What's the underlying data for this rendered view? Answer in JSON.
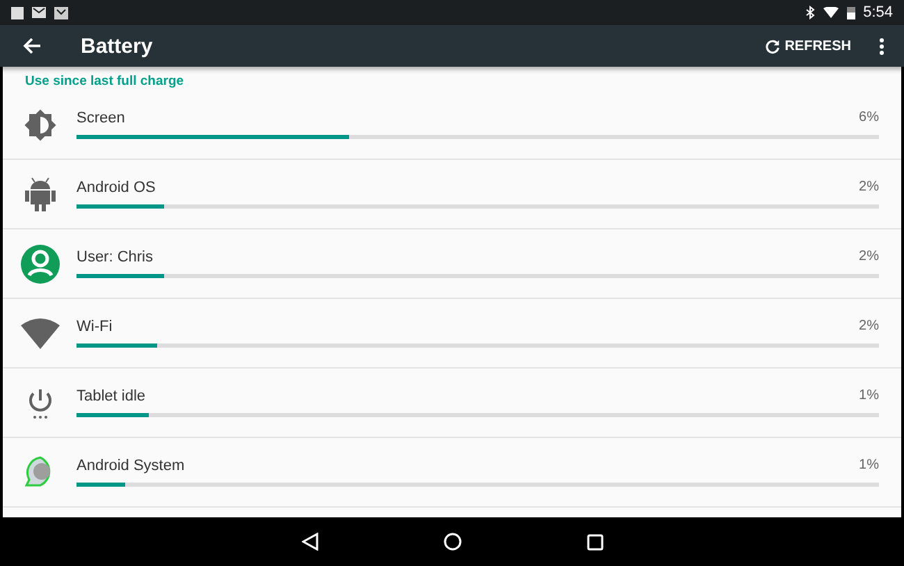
{
  "status_bar": {
    "time": "5:54"
  },
  "app_bar": {
    "title": "Battery",
    "action": "REFRESH"
  },
  "subheader": "Use since last full charge",
  "items": [
    {
      "kind": "brightness",
      "name": "Screen",
      "percent": "6%",
      "level": 0.34
    },
    {
      "kind": "android",
      "name": "Android OS",
      "percent": "2%",
      "level": 0.11
    },
    {
      "kind": "user",
      "name": "User: Chris",
      "percent": "2%",
      "level": 0.11
    },
    {
      "kind": "wifi",
      "name": "Wi-Fi",
      "percent": "2%",
      "level": 0.1
    },
    {
      "kind": "power",
      "name": "Tablet idle",
      "percent": "1%",
      "level": 0.09
    },
    {
      "kind": "system",
      "name": "Android System",
      "percent": "1%",
      "level": 0.06
    }
  ]
}
